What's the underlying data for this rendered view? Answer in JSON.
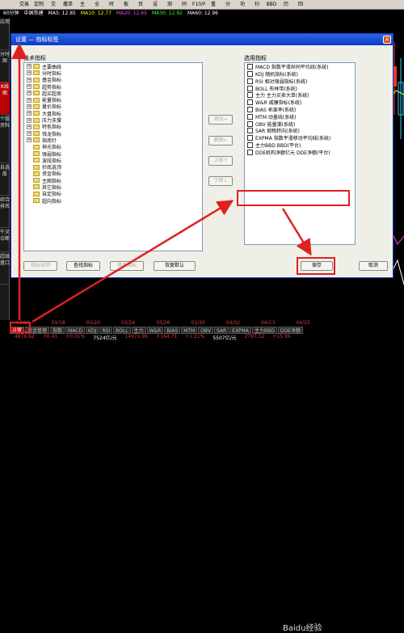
{
  "toolbar": {
    "items": [
      "交易",
      "定制",
      "交",
      "撒单",
      "主",
      "全",
      "时",
      "板",
      "页",
      "设",
      "测",
      "同",
      "F10/F9",
      "重",
      "分",
      "功",
      "扫",
      "BBD",
      "历",
      "回"
    ]
  },
  "status": {
    "period": "60分钟",
    "symbol": "中国铁建",
    "ma5": "MA5: 12.85",
    "ma10": "MA10: 12.77",
    "ma20": "MA20: 12.65",
    "ma30": "MA30: 12.92",
    "ma60": "MA60: 12.96"
  },
  "left_tabs": [
    "应用",
    "分时图",
    "K线图",
    "个股资料",
    "自选股",
    "综合排名",
    "牛叉诊断",
    "超级盘口"
  ],
  "dialog": {
    "title": "设置 — 指标标签",
    "close": "×",
    "tech_label": "技术指标",
    "selected_label": "选用指标",
    "tech_items": [
      {
        "t": "主要曲线",
        "p": true
      },
      {
        "t": "分时指标",
        "p": true
      },
      {
        "t": "基金指标",
        "p": true
      },
      {
        "t": "超势指标",
        "p": true
      },
      {
        "t": "超买超卖",
        "p": true
      },
      {
        "t": "能量指标",
        "p": true
      },
      {
        "t": "量价指标",
        "p": true
      },
      {
        "t": "大盘指标",
        "p": true
      },
      {
        "t": "压力支撑",
        "p": true
      },
      {
        "t": "特色指标",
        "p": true
      },
      {
        "t": "钱龙指标",
        "p": true
      },
      {
        "t": "指南针",
        "p": true
      },
      {
        "t": "神光指标",
        "p": false
      },
      {
        "t": "强弱指标",
        "p": false
      },
      {
        "t": "波段指标",
        "p": false
      },
      {
        "t": "抄底选顶",
        "p": false
      },
      {
        "t": "资金指标",
        "p": false
      },
      {
        "t": "主图指标",
        "p": false
      },
      {
        "t": "其它指标",
        "p": false
      },
      {
        "t": "自定指标",
        "p": false
      },
      {
        "t": "超向指标",
        "p": false
      }
    ],
    "selected_items": [
      "MACD 指数平滑异同平均线(系统)",
      "KDJ 随机指标(系统)",
      "RSI 相对强弱指标(系统)",
      "BOLL 布林带(系统)",
      "主力 主力买卖大单(系统)",
      "W&R 威廉指标(系统)",
      "BIAS 乖离率(系统)",
      "MTM 动量线(系统)",
      "OBV 能量潮(系统)",
      "SAR 抛物转向(系统)",
      "EXPMA 指数平滑移动平均线(系统)",
      "主力BBD BBD(平台)",
      "DDE机构净额亿元 DDE净额(平台)"
    ],
    "buttons": {
      "add": "添加→",
      "remove": "删除←",
      "up": "上移↑",
      "down": "下移↓",
      "explain": "指标说明",
      "find": "查找指标",
      "modify": "修改指标",
      "restore": "恢复默认",
      "save": "保存",
      "cancel": "取消"
    }
  },
  "bottom": {
    "dates": [
      "03/16",
      "03/18",
      "03/20",
      "03/24",
      "03/26",
      "03/30",
      "04/02",
      "04/13",
      "04/15"
    ],
    "tabs": [
      "设置",
      "资金管理",
      "指数",
      "MACD",
      "KDJ",
      "RSI",
      "BOLL",
      "主力",
      "W&R",
      "BIAS",
      "MTM",
      "OBV",
      "SAR",
      "EXPMA",
      "主力BBD",
      "DDE净额"
    ],
    "values": [
      "4876.62",
      "+0.41",
      "+0.01%",
      "7524亿/元",
      "14971.95",
      "+164.71",
      "+1.21%",
      "5507亿/元",
      "2797.52",
      "+15.99"
    ],
    "watermark": "Baidu经验"
  }
}
